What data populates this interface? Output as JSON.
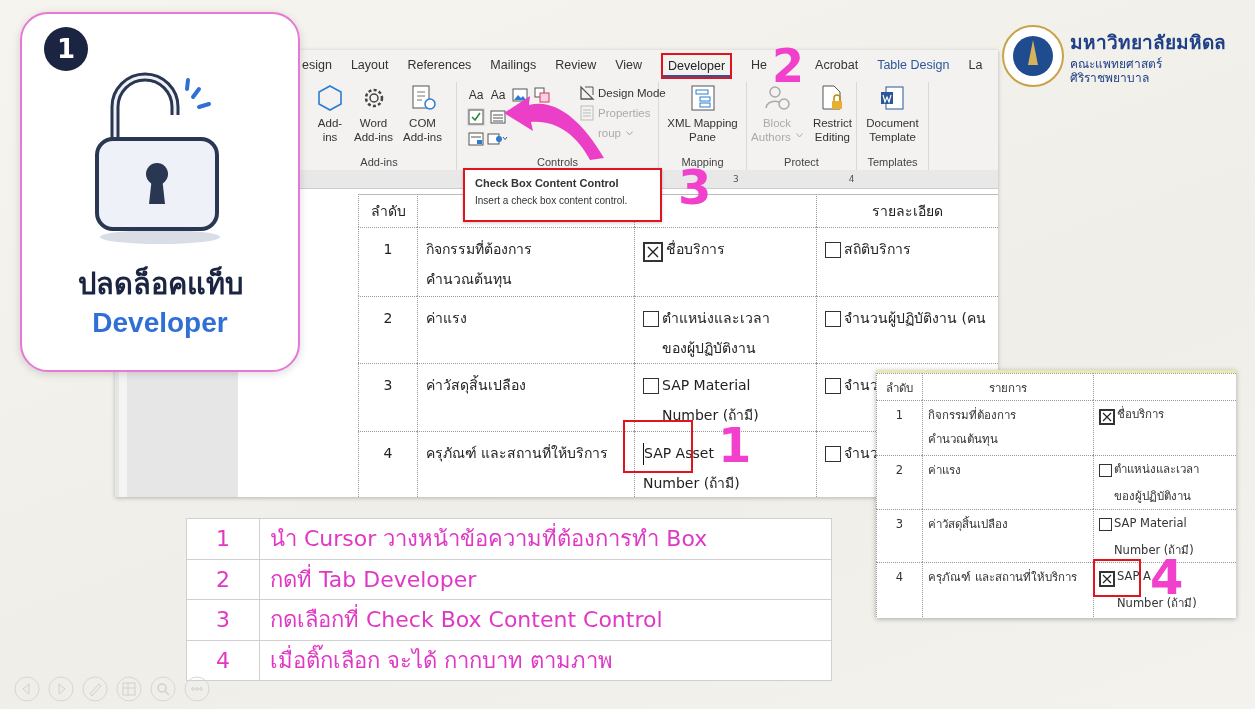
{
  "card": {
    "badge": "1",
    "title": "ปลดล็อคแท็บ",
    "subtitle": "Developer"
  },
  "logo": {
    "name": "มหาวิทยาลัยมหิดล",
    "lines": [
      "คณะแพทยศาสตร์",
      "ศิริราชพยาบาล"
    ]
  },
  "ribbon": {
    "tabs": [
      {
        "label": "esign",
        "selected": false,
        "kind": "normal"
      },
      {
        "label": "Layout",
        "selected": false,
        "kind": "normal"
      },
      {
        "label": "References",
        "selected": false,
        "kind": "normal"
      },
      {
        "label": "Mailings",
        "selected": false,
        "kind": "normal"
      },
      {
        "label": "Review",
        "selected": false,
        "kind": "normal"
      },
      {
        "label": "View",
        "selected": false,
        "kind": "normal"
      },
      {
        "label": "Developer",
        "selected": true,
        "kind": "normal"
      },
      {
        "label": "He",
        "selected": false,
        "kind": "normal"
      },
      {
        "label": "Acrobat",
        "selected": false,
        "kind": "normal"
      },
      {
        "label": "Table Design",
        "selected": false,
        "kind": "contextual"
      },
      {
        "label": "La",
        "selected": false,
        "kind": "normal"
      }
    ],
    "groups": [
      {
        "label": "Add-ins",
        "kind": "large",
        "buttons": [
          {
            "lines": [
              "Add-",
              "ins"
            ],
            "disabled": false
          },
          {
            "lines": [
              "Word",
              "Add-ins"
            ],
            "disabled": false
          },
          {
            "lines": [
              "COM",
              "Add-ins"
            ],
            "disabled": false
          }
        ]
      },
      {
        "label": "Controls",
        "kind": "controls",
        "glyphs": [
          "Aa",
          "Aa"
        ],
        "buttons": [
          {
            "lines": [
              "Design Mode"
            ],
            "disabled": false
          },
          {
            "lines": [
              "Properties"
            ],
            "disabled": true
          },
          {
            "lines": [
              "roup"
            ],
            "disabled": true
          }
        ]
      },
      {
        "label": "Mapping",
        "kind": "large",
        "buttons": [
          {
            "lines": [
              "XML Mapping",
              "Pane"
            ],
            "disabled": false
          }
        ]
      },
      {
        "label": "Protect",
        "kind": "large",
        "buttons": [
          {
            "lines": [
              "Block",
              "Authors"
            ],
            "disabled": true
          },
          {
            "lines": [
              "Restrict",
              "Editing"
            ],
            "disabled": false
          }
        ]
      },
      {
        "label": "Templates",
        "kind": "large",
        "buttons": [
          {
            "lines": [
              "Document",
              "Template"
            ],
            "disabled": false
          }
        ]
      }
    ]
  },
  "ruler": {
    "labels": [
      "3",
      "4"
    ]
  },
  "tooltip": {
    "title": "Check Box Content Control",
    "text": "Insert a check box content control."
  },
  "doc_table": {
    "header": {
      "number": "ลำดับ",
      "details": "รายละเอียด"
    },
    "rows": [
      {
        "number": "1",
        "item": [
          "กิจกรรมที่ต้องการ",
          "คำนวณต้นทุน"
        ],
        "options": [
          {
            "kind": "checkbox",
            "checked": true,
            "lines": [
              "ชื่อบริการ"
            ]
          },
          {
            "kind": "checkbox",
            "checked": false,
            "lines": [
              "สถิติบริการ"
            ]
          }
        ]
      },
      {
        "number": "2",
        "item": [
          "ค่าแรง"
        ],
        "options": [
          {
            "kind": "checkbox",
            "checked": false,
            "lines": [
              "ตำแหน่งและเวลา",
              "ของผู้ปฏิบัติงาน"
            ]
          },
          {
            "kind": "checkbox",
            "checked": false,
            "lines": [
              "จำนวนผู้ปฏิบัติงาน (คน"
            ]
          }
        ]
      },
      {
        "number": "3",
        "item": [
          "ค่าวัสดุสิ้นเปลือง"
        ],
        "options": [
          {
            "kind": "checkbox",
            "checked": false,
            "lines": [
              "SAP Material",
              "Number (ถ้ามี)"
            ]
          },
          {
            "kind": "checkbox",
            "checked": false,
            "lines": [
              "จำนว"
            ]
          }
        ]
      },
      {
        "number": "4",
        "item": [
          "ครุภัณฑ์ และสถานที่ให้บริการ"
        ],
        "options": [
          {
            "kind": "text",
            "cursor": true,
            "lines": [
              "SAP Asset",
              "Number (ถ้ามี)"
            ]
          },
          {
            "kind": "checkbox",
            "checked": false,
            "lines": [
              "จำนว"
            ]
          }
        ]
      }
    ]
  },
  "result_table": {
    "header": {
      "number": "ลำดับ",
      "item": "รายการ"
    },
    "rows": [
      {
        "number": "1",
        "item": [
          "กิจกรรมที่ต้องการ",
          "คำนวณต้นทุน"
        ],
        "option": {
          "checked": true,
          "lines": [
            "ชื่อบริการ"
          ]
        }
      },
      {
        "number": "2",
        "item": [
          "ค่าแรง"
        ],
        "option": {
          "checked": false,
          "lines": [
            "ตำแหน่งและเวลา",
            "ของผู้ปฏิบัติงาน"
          ]
        }
      },
      {
        "number": "3",
        "item": [
          "ค่าวัสดุสิ้นเปลือง"
        ],
        "option": {
          "checked": false,
          "lines": [
            "SAP Material",
            "Number (ถ้ามี)"
          ]
        }
      },
      {
        "number": "4",
        "item": [
          "ครุภัณฑ์ และสถานที่ให้บริการ"
        ],
        "option": {
          "checked": true,
          "lines": [
            "SAP A",
            "Number (ถ้ามี)"
          ]
        }
      }
    ]
  },
  "markers": [
    "1",
    "2",
    "3",
    "4"
  ],
  "steps": [
    {
      "number": "1",
      "text": "นำ Cursor วางหน้าข้อความที่ต้องการทำ Box"
    },
    {
      "number": "2",
      "text": "กดที่ Tab Developer"
    },
    {
      "number": "3",
      "text": "กดเลือกที่ Check Box Content Control"
    },
    {
      "number": "4",
      "text": "เมื่อติ๊กเลือก จะได้ กากบาท ตามภาพ"
    }
  ]
}
